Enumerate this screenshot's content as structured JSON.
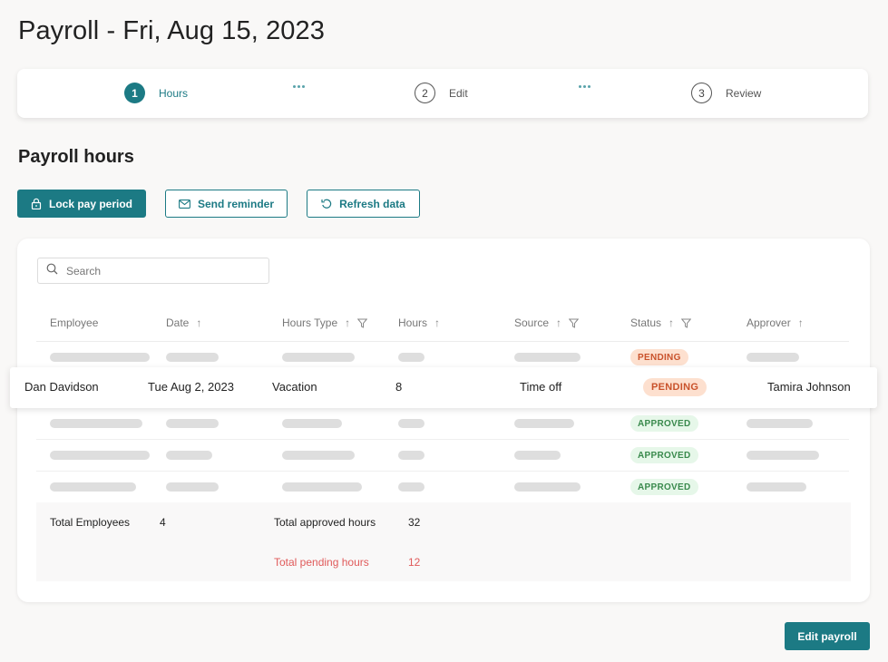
{
  "page": {
    "title": "Payroll - Fri, Aug 15, 2023",
    "section_title": "Payroll hours"
  },
  "stepper": {
    "steps": [
      {
        "number": "1",
        "label": "Hours",
        "state": "active"
      },
      {
        "number": "2",
        "label": "Edit",
        "state": "inactive"
      },
      {
        "number": "3",
        "label": "Review",
        "state": "inactive"
      }
    ]
  },
  "toolbar": {
    "lock_label": "Lock pay period",
    "reminder_label": "Send reminder",
    "refresh_label": "Refresh data"
  },
  "search": {
    "placeholder": "Search",
    "value": ""
  },
  "table": {
    "columns": [
      {
        "label": "Employee",
        "sortable": false,
        "filterable": false
      },
      {
        "label": "Date",
        "sortable": true,
        "filterable": false
      },
      {
        "label": "Hours Type",
        "sortable": true,
        "filterable": true
      },
      {
        "label": "Hours",
        "sortable": true,
        "filterable": false
      },
      {
        "label": "Source",
        "sortable": true,
        "filterable": true
      },
      {
        "label": "Status",
        "sortable": true,
        "filterable": true
      },
      {
        "label": "Approver",
        "sortable": true,
        "filterable": false
      }
    ],
    "rows": [
      {
        "placeholder": true,
        "status": "PENDING"
      },
      {
        "employee": "Dan Davidson",
        "date": "Tue Aug 2, 2023",
        "hours_type": "Vacation",
        "hours": "8",
        "source": "Time off",
        "status": "PENDING",
        "approver": "Tamira Johnson",
        "highlighted": true
      },
      {
        "placeholder": true,
        "status": "APPROVED"
      },
      {
        "placeholder": true,
        "status": "APPROVED"
      },
      {
        "placeholder": true,
        "status": "APPROVED"
      }
    ]
  },
  "totals": {
    "employees_label": "Total Employees",
    "employees_value": "4",
    "approved_label": "Total approved hours",
    "approved_value": "32",
    "pending_label": "Total pending hours",
    "pending_value": "12"
  },
  "footer": {
    "edit_label": "Edit payroll"
  },
  "colors": {
    "accent": "#1c7a84",
    "pending_bg": "#fde0cf",
    "pending_text": "#c9522b",
    "approved_bg": "#e6f7e9",
    "approved_text": "#3a8a4d",
    "pending_total": "#e05a5a"
  }
}
